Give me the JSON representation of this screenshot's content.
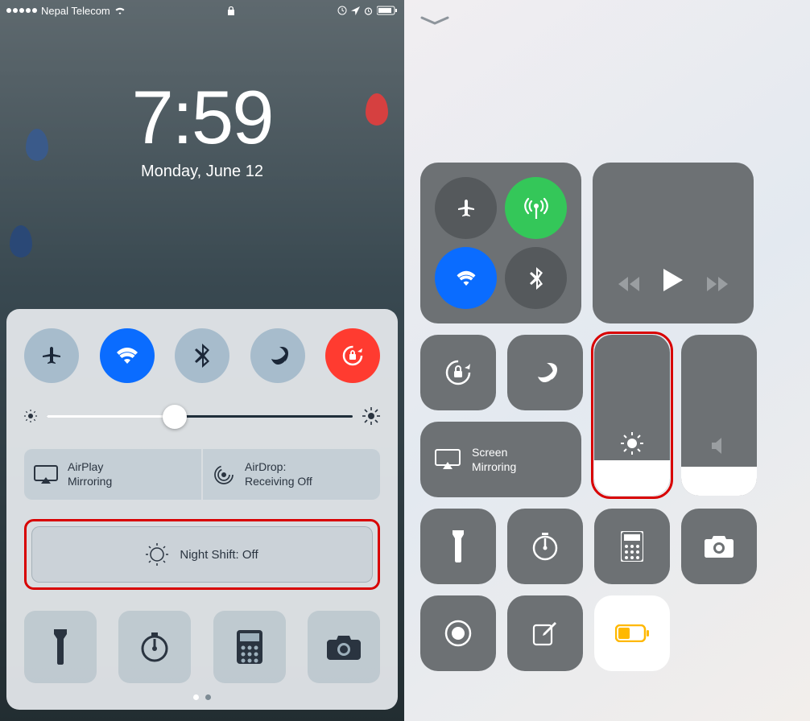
{
  "left": {
    "statusbar": {
      "carrier": "Nepal Telecom"
    },
    "lockscreen": {
      "time": "7:59",
      "date": "Monday, June 12"
    },
    "controlcenter": {
      "toggles": {
        "airplane": "airplane",
        "wifi": "wifi",
        "bluetooth": "bluetooth",
        "dnd": "do-not-disturb",
        "rotation": "rotation-lock"
      },
      "airplay_label": "AirPlay\nMirroring",
      "airdrop_label": "AirDrop:\nReceiving Off",
      "nightshift_label": "Night Shift: Off"
    }
  },
  "right": {
    "screen_mirroring_label": "Screen\nMirroring"
  }
}
